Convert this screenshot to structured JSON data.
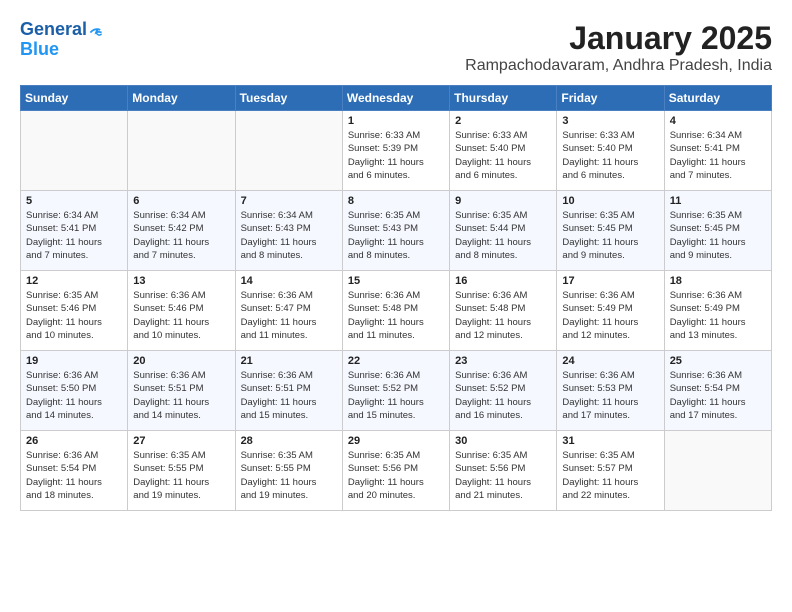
{
  "logo": {
    "line1": "General",
    "line2": "Blue"
  },
  "title": "January 2025",
  "subtitle": "Rampachodavaram, Andhra Pradesh, India",
  "headers": [
    "Sunday",
    "Monday",
    "Tuesday",
    "Wednesday",
    "Thursday",
    "Friday",
    "Saturday"
  ],
  "weeks": [
    [
      {
        "day": "",
        "info": ""
      },
      {
        "day": "",
        "info": ""
      },
      {
        "day": "",
        "info": ""
      },
      {
        "day": "1",
        "info": "Sunrise: 6:33 AM\nSunset: 5:39 PM\nDaylight: 11 hours\nand 6 minutes."
      },
      {
        "day": "2",
        "info": "Sunrise: 6:33 AM\nSunset: 5:40 PM\nDaylight: 11 hours\nand 6 minutes."
      },
      {
        "day": "3",
        "info": "Sunrise: 6:33 AM\nSunset: 5:40 PM\nDaylight: 11 hours\nand 6 minutes."
      },
      {
        "day": "4",
        "info": "Sunrise: 6:34 AM\nSunset: 5:41 PM\nDaylight: 11 hours\nand 7 minutes."
      }
    ],
    [
      {
        "day": "5",
        "info": "Sunrise: 6:34 AM\nSunset: 5:41 PM\nDaylight: 11 hours\nand 7 minutes."
      },
      {
        "day": "6",
        "info": "Sunrise: 6:34 AM\nSunset: 5:42 PM\nDaylight: 11 hours\nand 7 minutes."
      },
      {
        "day": "7",
        "info": "Sunrise: 6:34 AM\nSunset: 5:43 PM\nDaylight: 11 hours\nand 8 minutes."
      },
      {
        "day": "8",
        "info": "Sunrise: 6:35 AM\nSunset: 5:43 PM\nDaylight: 11 hours\nand 8 minutes."
      },
      {
        "day": "9",
        "info": "Sunrise: 6:35 AM\nSunset: 5:44 PM\nDaylight: 11 hours\nand 8 minutes."
      },
      {
        "day": "10",
        "info": "Sunrise: 6:35 AM\nSunset: 5:45 PM\nDaylight: 11 hours\nand 9 minutes."
      },
      {
        "day": "11",
        "info": "Sunrise: 6:35 AM\nSunset: 5:45 PM\nDaylight: 11 hours\nand 9 minutes."
      }
    ],
    [
      {
        "day": "12",
        "info": "Sunrise: 6:35 AM\nSunset: 5:46 PM\nDaylight: 11 hours\nand 10 minutes."
      },
      {
        "day": "13",
        "info": "Sunrise: 6:36 AM\nSunset: 5:46 PM\nDaylight: 11 hours\nand 10 minutes."
      },
      {
        "day": "14",
        "info": "Sunrise: 6:36 AM\nSunset: 5:47 PM\nDaylight: 11 hours\nand 11 minutes."
      },
      {
        "day": "15",
        "info": "Sunrise: 6:36 AM\nSunset: 5:48 PM\nDaylight: 11 hours\nand 11 minutes."
      },
      {
        "day": "16",
        "info": "Sunrise: 6:36 AM\nSunset: 5:48 PM\nDaylight: 11 hours\nand 12 minutes."
      },
      {
        "day": "17",
        "info": "Sunrise: 6:36 AM\nSunset: 5:49 PM\nDaylight: 11 hours\nand 12 minutes."
      },
      {
        "day": "18",
        "info": "Sunrise: 6:36 AM\nSunset: 5:49 PM\nDaylight: 11 hours\nand 13 minutes."
      }
    ],
    [
      {
        "day": "19",
        "info": "Sunrise: 6:36 AM\nSunset: 5:50 PM\nDaylight: 11 hours\nand 14 minutes."
      },
      {
        "day": "20",
        "info": "Sunrise: 6:36 AM\nSunset: 5:51 PM\nDaylight: 11 hours\nand 14 minutes."
      },
      {
        "day": "21",
        "info": "Sunrise: 6:36 AM\nSunset: 5:51 PM\nDaylight: 11 hours\nand 15 minutes."
      },
      {
        "day": "22",
        "info": "Sunrise: 6:36 AM\nSunset: 5:52 PM\nDaylight: 11 hours\nand 15 minutes."
      },
      {
        "day": "23",
        "info": "Sunrise: 6:36 AM\nSunset: 5:52 PM\nDaylight: 11 hours\nand 16 minutes."
      },
      {
        "day": "24",
        "info": "Sunrise: 6:36 AM\nSunset: 5:53 PM\nDaylight: 11 hours\nand 17 minutes."
      },
      {
        "day": "25",
        "info": "Sunrise: 6:36 AM\nSunset: 5:54 PM\nDaylight: 11 hours\nand 17 minutes."
      }
    ],
    [
      {
        "day": "26",
        "info": "Sunrise: 6:36 AM\nSunset: 5:54 PM\nDaylight: 11 hours\nand 18 minutes."
      },
      {
        "day": "27",
        "info": "Sunrise: 6:35 AM\nSunset: 5:55 PM\nDaylight: 11 hours\nand 19 minutes."
      },
      {
        "day": "28",
        "info": "Sunrise: 6:35 AM\nSunset: 5:55 PM\nDaylight: 11 hours\nand 19 minutes."
      },
      {
        "day": "29",
        "info": "Sunrise: 6:35 AM\nSunset: 5:56 PM\nDaylight: 11 hours\nand 20 minutes."
      },
      {
        "day": "30",
        "info": "Sunrise: 6:35 AM\nSunset: 5:56 PM\nDaylight: 11 hours\nand 21 minutes."
      },
      {
        "day": "31",
        "info": "Sunrise: 6:35 AM\nSunset: 5:57 PM\nDaylight: 11 hours\nand 22 minutes."
      },
      {
        "day": "",
        "info": ""
      }
    ]
  ]
}
